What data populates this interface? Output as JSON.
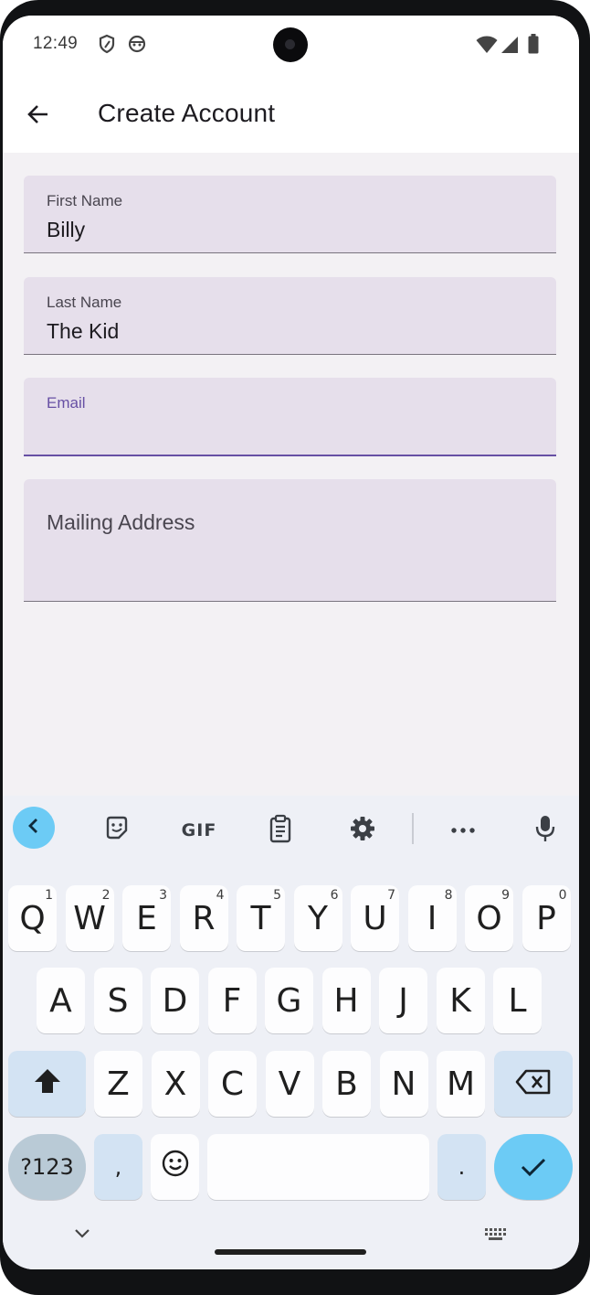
{
  "status_bar": {
    "time": "12:49"
  },
  "app_bar": {
    "title": "Create Account"
  },
  "form": {
    "first_name": {
      "label": "First Name",
      "value": "Billy"
    },
    "last_name": {
      "label": "Last Name",
      "value": "The Kid"
    },
    "email": {
      "label": "Email",
      "value": ""
    },
    "mailing_address": {
      "placeholder": "Mailing Address"
    }
  },
  "keyboard": {
    "toolbar": {
      "gif_label": "GIF"
    },
    "row1": [
      {
        "key": "Q",
        "hint": "1"
      },
      {
        "key": "W",
        "hint": "2"
      },
      {
        "key": "E",
        "hint": "3"
      },
      {
        "key": "R",
        "hint": "4"
      },
      {
        "key": "T",
        "hint": "5"
      },
      {
        "key": "Y",
        "hint": "6"
      },
      {
        "key": "U",
        "hint": "7"
      },
      {
        "key": "I",
        "hint": "8"
      },
      {
        "key": "O",
        "hint": "9"
      },
      {
        "key": "P",
        "hint": "0"
      }
    ],
    "row2": [
      "A",
      "S",
      "D",
      "F",
      "G",
      "H",
      "J",
      "K",
      "L"
    ],
    "row3": [
      "Z",
      "X",
      "C",
      "V",
      "B",
      "N",
      "M"
    ],
    "symbols_label": "?123",
    "comma": ",",
    "period": "."
  },
  "colors": {
    "field_bg": "#e6dfeb",
    "focus_accent": "#6750a4",
    "keyboard_accent": "#6ccbf5"
  }
}
